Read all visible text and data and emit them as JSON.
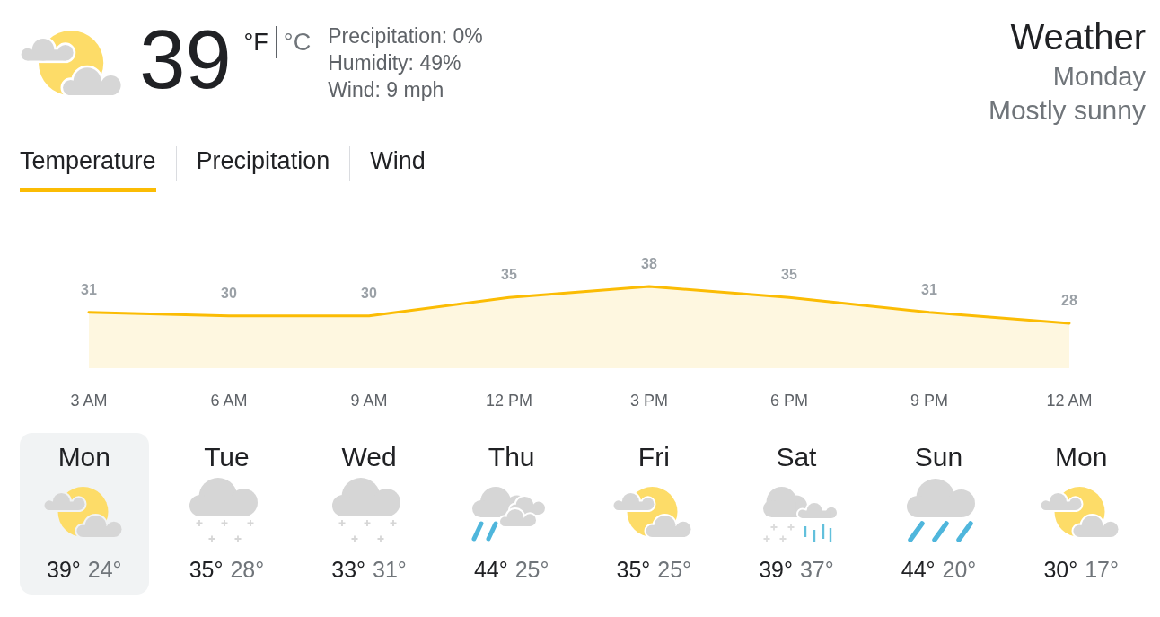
{
  "current": {
    "kind": "partly",
    "temperature": "39",
    "units": [
      {
        "label": "°F",
        "selected": true
      },
      {
        "label": "°C",
        "selected": false
      }
    ],
    "details": [
      "Precipitation: 0%",
      "Humidity: 49%",
      "Wind: 9 mph"
    ]
  },
  "summary": {
    "title": "Weather",
    "day": "Monday",
    "condition": "Mostly sunny"
  },
  "tabs": [
    {
      "label": "Temperature",
      "selected": true
    },
    {
      "label": "Precipitation",
      "selected": false
    },
    {
      "label": "Wind",
      "selected": false
    }
  ],
  "chart": {
    "chart_data": {
      "type": "area",
      "categories": [
        "3 AM",
        "6 AM",
        "9 AM",
        "12 PM",
        "3 PM",
        "6 PM",
        "9 PM",
        "12 AM"
      ],
      "values": [
        31,
        30,
        30,
        35,
        38,
        35,
        31,
        28
      ],
      "data_labels": true
    }
  },
  "days": [
    {
      "day": "Mon",
      "kind": "partly",
      "high": "39°",
      "low": "24°",
      "selected": true
    },
    {
      "day": "Tue",
      "kind": "snow",
      "high": "35°",
      "low": "28°",
      "selected": false
    },
    {
      "day": "Wed",
      "kind": "snow",
      "high": "33°",
      "low": "31°",
      "selected": false
    },
    {
      "day": "Thu",
      "kind": "showers",
      "high": "44°",
      "low": "25°",
      "selected": false
    },
    {
      "day": "Fri",
      "kind": "partly",
      "high": "35°",
      "low": "25°",
      "selected": false
    },
    {
      "day": "Sat",
      "kind": "mix",
      "high": "39°",
      "low": "37°",
      "selected": false
    },
    {
      "day": "Sun",
      "kind": "rain",
      "high": "44°",
      "low": "20°",
      "selected": false
    },
    {
      "day": "Mon",
      "kind": "partly",
      "high": "30°",
      "low": "17°",
      "selected": false
    }
  ]
}
